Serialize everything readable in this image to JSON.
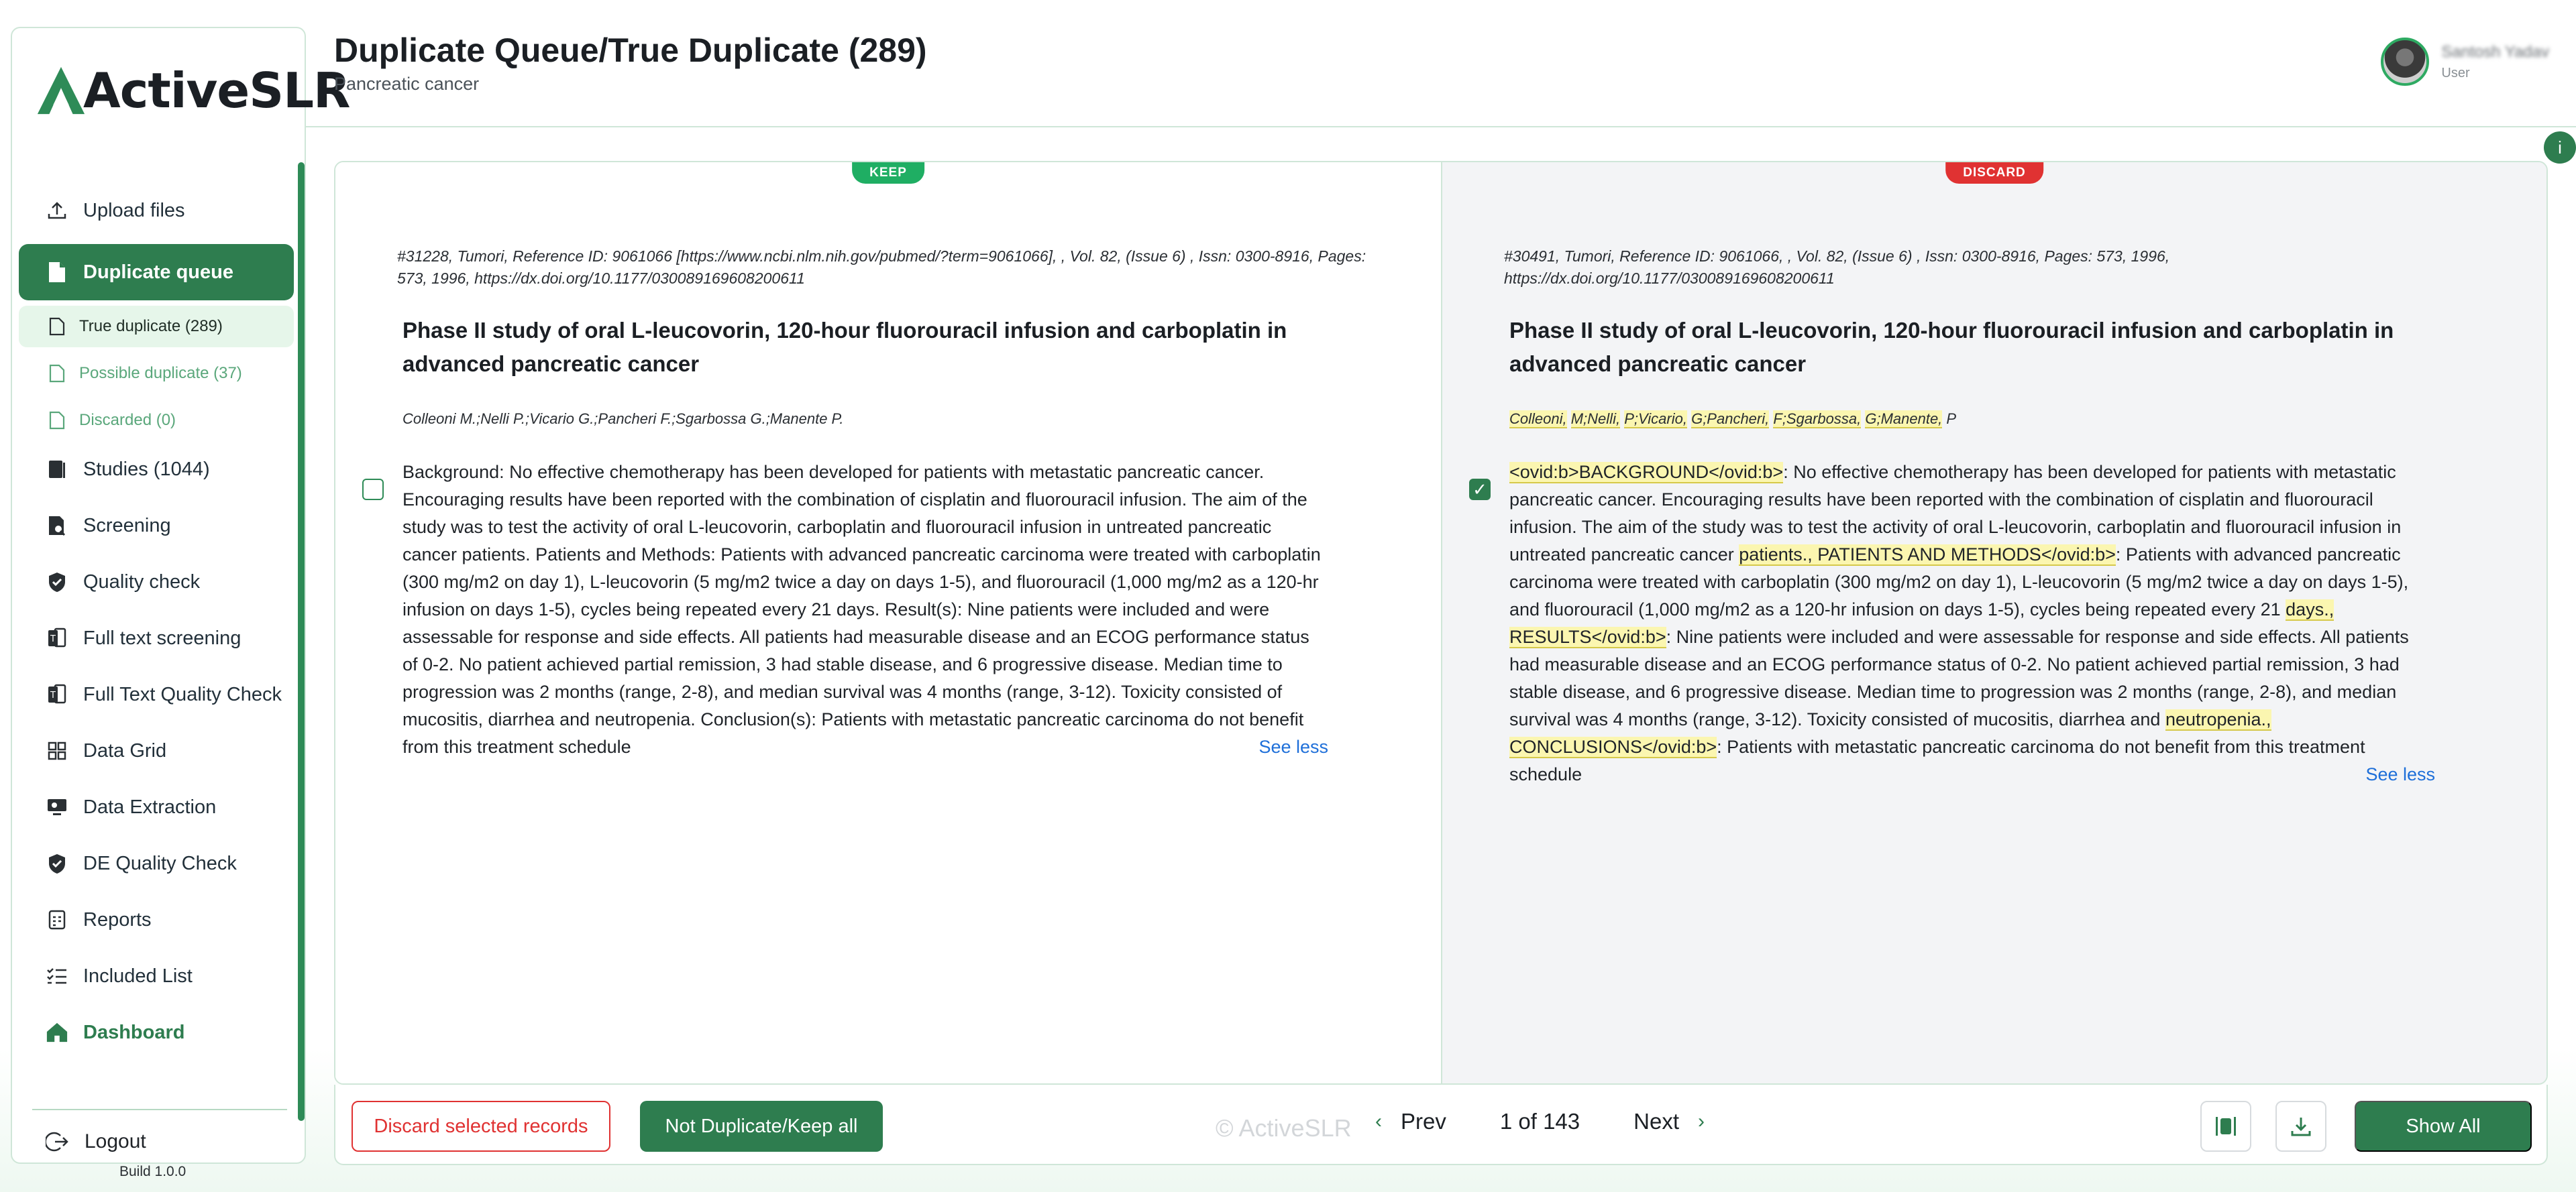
{
  "app": {
    "name": "ActiveSLR",
    "build": "Build 1.0.0"
  },
  "sidebar": {
    "items": [
      {
        "label": "Upload files",
        "icon": "upload-icon"
      },
      {
        "label": "Duplicate queue",
        "icon": "file-icon"
      },
      {
        "label": "Studies (1044)",
        "icon": "books-icon"
      },
      {
        "label": "Screening",
        "icon": "document-search-icon"
      },
      {
        "label": "Quality check",
        "icon": "shield-check-icon"
      },
      {
        "label": "Full text screening",
        "icon": "full-text-icon"
      },
      {
        "label": "Full Text Quality Check",
        "icon": "full-text-quality-icon"
      },
      {
        "label": "Data Grid",
        "icon": "grid-icon"
      },
      {
        "label": "Data Extraction",
        "icon": "extraction-icon"
      },
      {
        "label": "DE Quality Check",
        "icon": "shield-check-icon"
      },
      {
        "label": "Reports",
        "icon": "report-icon"
      },
      {
        "label": "Included List",
        "icon": "checklist-icon"
      },
      {
        "label": "Dashboard",
        "icon": "home-icon"
      }
    ],
    "sub_items": [
      {
        "label": "True duplicate (289)"
      },
      {
        "label": "Possible duplicate (37)"
      },
      {
        "label": "Discarded (0)"
      }
    ],
    "logout": "Logout"
  },
  "header": {
    "title": "Duplicate Queue/True Duplicate (289)",
    "subtitle": "Pancreatic cancer",
    "user_name": "Santosh Yadav",
    "user_role": "User",
    "info": "i"
  },
  "records": {
    "left": {
      "badge": "KEEP",
      "meta": "#31228, Tumori,  Reference ID: 9061066 [https://www.ncbi.nlm.nih.gov/pubmed/?term=9061066], , Vol. 82,  (Issue 6) ,  Issn: 0300-8916,  Pages: 573,  1996,  https://dx.doi.org/10.1177/030089169608200611",
      "title": "Phase II study of oral L-leucovorin, 120-hour fluorouracil infusion and carboplatin in advanced pancreatic cancer",
      "authors": "Colleoni M.;Nelli P.;Vicario G.;Pancheri F.;Sgarbossa G.;Manente P.",
      "abstract": "Background: No effective chemotherapy has been developed for patients with metastatic pancreatic cancer. Encouraging results have been reported with the combination of cisplatin and fluorouracil infusion. The aim of the study was to test the activity of oral L-leucovorin, carboplatin and fluorouracil infusion in untreated pancreatic cancer patients. Patients and Methods: Patients with advanced pancreatic carcinoma were treated with carboplatin (300 mg/m2 on day 1), L-leucovorin (5 mg/m2 twice a day on days 1-5), and fluorouracil (1,000 mg/m2 as a 120-hr infusion on days 1-5), cycles being repeated every 21 days. Result(s): Nine patients were included and were assessable for response and side effects. All patients had measurable disease and an ECOG performance status of 0-2. No patient achieved partial remission, 3 had stable disease, and 6 progressive disease. Median time to progression was 2 months (range, 2-8), and median survival was 4 months (range, 3-12). Toxicity consisted of mucositis, diarrhea and neutropenia. Conclusion(s): Patients with metastatic pancreatic carcinoma do not benefit from this treatment schedule",
      "checked": false,
      "see_less": "See less"
    },
    "right": {
      "badge": "DISCARD",
      "meta": "#30491, Tumori,  Reference ID: 9061066, , Vol. 82,  (Issue 6) ,  Issn: 0300-8916,  Pages: 573,  1996,  https://dx.doi.org/10.1177/030089169608200611",
      "title": "Phase II study of oral L-leucovorin, 120-hour fluorouracil infusion and carboplatin in advanced pancreatic cancer",
      "authors": [
        "Colleoni,",
        "M;Nelli,",
        "P;Vicario,",
        "G;Pancheri,",
        "F;Sgarbossa,",
        "G;Manente,",
        "P"
      ],
      "abstract_parts": [
        {
          "t": "<ovid:b>BACKGROUND</ovid:b>",
          "hl": true
        },
        {
          "t": ": No effective chemotherapy has been developed for patients with metastatic pancreatic cancer. Encouraging results have been reported with the combination of cisplatin and fluorouracil infusion. The aim of the study was to test the activity of oral L-leucovorin, carboplatin and fluorouracil infusion in untreated pancreatic cancer ",
          "hl": false
        },
        {
          "t": "patients., PATIENTS AND METHODS</ovid:b>",
          "hl": true
        },
        {
          "t": ": Patients with advanced pancreatic carcinoma were treated with carboplatin (300 mg/m2 on day 1), L-leucovorin (5 mg/m2 twice a day on days 1-5), and fluorouracil (1,000 mg/m2 as a 120-hr infusion on days 1-5), cycles being repeated every 21 ",
          "hl": false
        },
        {
          "t": "days., RESULTS</ovid:b>",
          "hl": true
        },
        {
          "t": ": Nine patients were included and were assessable for response and side effects. All patients had measurable disease and an ECOG performance status of 0-2. No patient achieved partial remission, 3 had stable disease, and 6 progressive disease. Median time to progression was 2 months (range, 2-8), and median survival was 4 months (range, 3-12). Toxicity consisted of mucositis, diarrhea and ",
          "hl": false
        },
        {
          "t": "neutropenia., CONCLUSIONS</ovid:b>",
          "hl": true
        },
        {
          "t": ": Patients with metastatic pancreatic carcinoma do not benefit from this treatment schedule",
          "hl": false
        }
      ],
      "checked": true,
      "see_less": "See less"
    }
  },
  "footer": {
    "discard_label": "Discard selected records",
    "keep_label": "Not Duplicate/Keep all",
    "watermark": "© ActiveSLR",
    "prev_label": "Prev",
    "page_text": "1 of 143",
    "next_label": "Next",
    "show_all_label": "Show All"
  },
  "colors": {
    "brand": "#2e7d4f",
    "keep": "#1fae63",
    "discard": "#e03232",
    "link": "#1e6fd9"
  }
}
